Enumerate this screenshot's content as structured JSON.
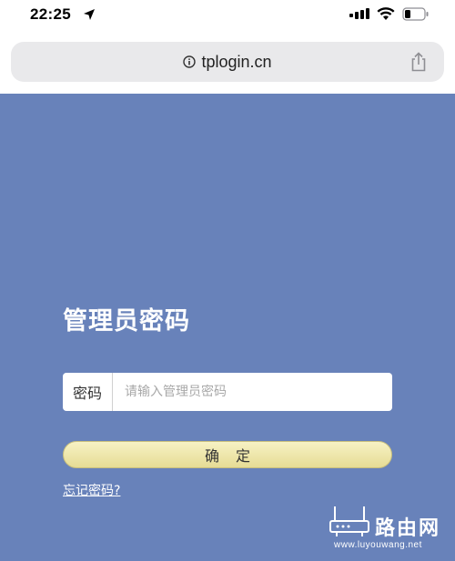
{
  "status_bar": {
    "time": "22:25",
    "icons": [
      "location-arrow-icon",
      "signal-icon",
      "wifi-icon",
      "battery-icon"
    ]
  },
  "browser": {
    "url": "tplogin.cn",
    "icons": [
      "info-icon",
      "share-icon"
    ],
    "address_bar_color": "#e9e9eb"
  },
  "login": {
    "title": "管理员密码",
    "password_label": "密码",
    "password_placeholder": "请输入管理员密码",
    "password_value": "",
    "confirm_label": "确定",
    "forgot_link": "忘记密码?"
  },
  "watermark": {
    "brand": "路由网",
    "url": "www.luyouwang.net"
  },
  "colors": {
    "background": "#6882ba",
    "button_gradient_top": "#f7f2c4",
    "button_gradient_bottom": "#e6dc95",
    "text_on_background": "#ffffff"
  }
}
